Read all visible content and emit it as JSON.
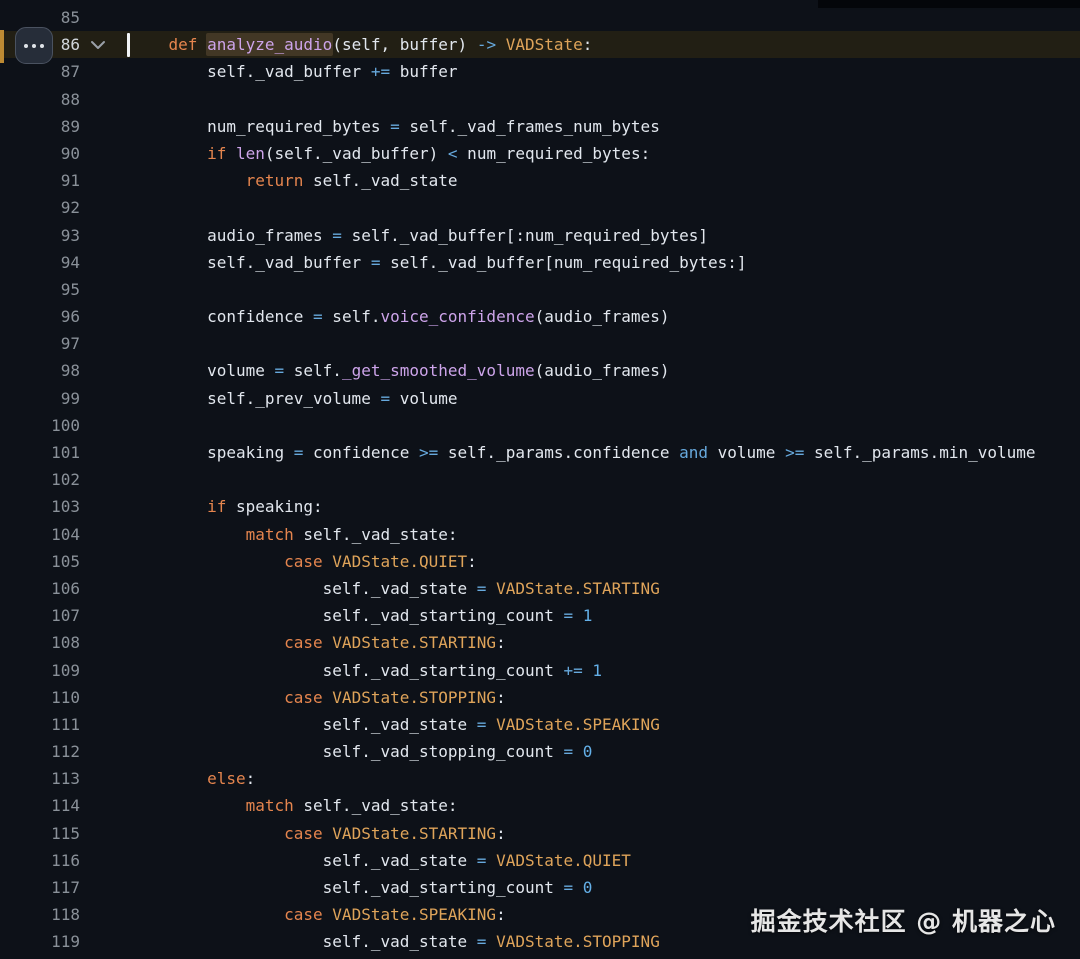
{
  "editor": {
    "colors": {
      "background": "#0d1118",
      "active_line_background": "#221f14",
      "plain": "#e2e7ee",
      "keyword": "#e5854e",
      "class_const": "#dfa45a",
      "function": "#cda4ea",
      "operator": "#67a9dd",
      "number": "#64b0e8",
      "selection_background": "#423725",
      "line_number": "#8a9199",
      "active_line_number": "#d2d7dd",
      "accent_bar": "#bd8a33"
    },
    "gutter": {
      "overflow_icon": "ellipsis-icon",
      "fold_icon": "chevron-down-icon"
    },
    "watermark": "掘金技术社区 @ 机器之心",
    "lines": [
      {
        "num": 85,
        "tokens": []
      },
      {
        "num": 86,
        "active": true,
        "cursor": true,
        "fold": true,
        "tokens": [
          [
            "p",
            "    "
          ],
          [
            "k",
            "def"
          ],
          [
            "p",
            " "
          ],
          [
            "fs",
            "analyze_audio"
          ],
          [
            "p",
            "(self, buffer) "
          ],
          [
            "o",
            "->"
          ],
          [
            "p",
            " "
          ],
          [
            "c",
            "VADState"
          ],
          [
            "p",
            ":"
          ]
        ]
      },
      {
        "num": 87,
        "tokens": [
          [
            "p",
            "        self._vad_buffer "
          ],
          [
            "o",
            "+="
          ],
          [
            "p",
            " buffer"
          ]
        ]
      },
      {
        "num": 88,
        "tokens": []
      },
      {
        "num": 89,
        "tokens": [
          [
            "p",
            "        num_required_bytes "
          ],
          [
            "o",
            "="
          ],
          [
            "p",
            " self._vad_frames_num_bytes"
          ]
        ]
      },
      {
        "num": 90,
        "tokens": [
          [
            "p",
            "        "
          ],
          [
            "k",
            "if"
          ],
          [
            "p",
            " "
          ],
          [
            "f",
            "len"
          ],
          [
            "p",
            "(self._vad_buffer) "
          ],
          [
            "o",
            "<"
          ],
          [
            "p",
            " num_required_bytes:"
          ]
        ]
      },
      {
        "num": 91,
        "tokens": [
          [
            "p",
            "            "
          ],
          [
            "k",
            "return"
          ],
          [
            "p",
            " self._vad_state"
          ]
        ]
      },
      {
        "num": 92,
        "tokens": []
      },
      {
        "num": 93,
        "tokens": [
          [
            "p",
            "        audio_frames "
          ],
          [
            "o",
            "="
          ],
          [
            "p",
            " self._vad_buffer[:num_required_bytes]"
          ]
        ]
      },
      {
        "num": 94,
        "tokens": [
          [
            "p",
            "        self._vad_buffer "
          ],
          [
            "o",
            "="
          ],
          [
            "p",
            " self._vad_buffer[num_required_bytes:]"
          ]
        ]
      },
      {
        "num": 95,
        "tokens": []
      },
      {
        "num": 96,
        "tokens": [
          [
            "p",
            "        confidence "
          ],
          [
            "o",
            "="
          ],
          [
            "p",
            " self."
          ],
          [
            "f",
            "voice_confidence"
          ],
          [
            "p",
            "(audio_frames)"
          ]
        ]
      },
      {
        "num": 97,
        "tokens": []
      },
      {
        "num": 98,
        "tokens": [
          [
            "p",
            "        volume "
          ],
          [
            "o",
            "="
          ],
          [
            "p",
            " self."
          ],
          [
            "f",
            "_get_smoothed_volume"
          ],
          [
            "p",
            "(audio_frames)"
          ]
        ]
      },
      {
        "num": 99,
        "tokens": [
          [
            "p",
            "        self._prev_volume "
          ],
          [
            "o",
            "="
          ],
          [
            "p",
            " volume"
          ]
        ]
      },
      {
        "num": 100,
        "tokens": []
      },
      {
        "num": 101,
        "tokens": [
          [
            "p",
            "        speaking "
          ],
          [
            "o",
            "="
          ],
          [
            "p",
            " confidence "
          ],
          [
            "o",
            ">="
          ],
          [
            "p",
            " self._params.confidence "
          ],
          [
            "o",
            "and"
          ],
          [
            "p",
            " volume "
          ],
          [
            "o",
            ">="
          ],
          [
            "p",
            " self._params.min_volume"
          ]
        ]
      },
      {
        "num": 102,
        "tokens": []
      },
      {
        "num": 103,
        "tokens": [
          [
            "p",
            "        "
          ],
          [
            "k",
            "if"
          ],
          [
            "p",
            " speaking:"
          ]
        ]
      },
      {
        "num": 104,
        "tokens": [
          [
            "p",
            "            "
          ],
          [
            "k",
            "match"
          ],
          [
            "p",
            " self._vad_state:"
          ]
        ]
      },
      {
        "num": 105,
        "tokens": [
          [
            "p",
            "                "
          ],
          [
            "k",
            "case"
          ],
          [
            "p",
            " "
          ],
          [
            "c",
            "VADState.QUIET"
          ],
          [
            "p",
            ":"
          ]
        ]
      },
      {
        "num": 106,
        "tokens": [
          [
            "p",
            "                    self._vad_state "
          ],
          [
            "o",
            "="
          ],
          [
            "p",
            " "
          ],
          [
            "c",
            "VADState.STARTING"
          ]
        ]
      },
      {
        "num": 107,
        "tokens": [
          [
            "p",
            "                    self._vad_starting_count "
          ],
          [
            "o",
            "="
          ],
          [
            "p",
            " "
          ],
          [
            "n",
            "1"
          ]
        ]
      },
      {
        "num": 108,
        "tokens": [
          [
            "p",
            "                "
          ],
          [
            "k",
            "case"
          ],
          [
            "p",
            " "
          ],
          [
            "c",
            "VADState.STARTING"
          ],
          [
            "p",
            ":"
          ]
        ]
      },
      {
        "num": 109,
        "tokens": [
          [
            "p",
            "                    self._vad_starting_count "
          ],
          [
            "o",
            "+="
          ],
          [
            "p",
            " "
          ],
          [
            "n",
            "1"
          ]
        ]
      },
      {
        "num": 110,
        "tokens": [
          [
            "p",
            "                "
          ],
          [
            "k",
            "case"
          ],
          [
            "p",
            " "
          ],
          [
            "c",
            "VADState.STOPPING"
          ],
          [
            "p",
            ":"
          ]
        ]
      },
      {
        "num": 111,
        "tokens": [
          [
            "p",
            "                    self._vad_state "
          ],
          [
            "o",
            "="
          ],
          [
            "p",
            " "
          ],
          [
            "c",
            "VADState.SPEAKING"
          ]
        ]
      },
      {
        "num": 112,
        "tokens": [
          [
            "p",
            "                    self._vad_stopping_count "
          ],
          [
            "o",
            "="
          ],
          [
            "p",
            " "
          ],
          [
            "n",
            "0"
          ]
        ]
      },
      {
        "num": 113,
        "tokens": [
          [
            "p",
            "        "
          ],
          [
            "k",
            "else"
          ],
          [
            "p",
            ":"
          ]
        ]
      },
      {
        "num": 114,
        "tokens": [
          [
            "p",
            "            "
          ],
          [
            "k",
            "match"
          ],
          [
            "p",
            " self._vad_state:"
          ]
        ]
      },
      {
        "num": 115,
        "tokens": [
          [
            "p",
            "                "
          ],
          [
            "k",
            "case"
          ],
          [
            "p",
            " "
          ],
          [
            "c",
            "VADState.STARTING"
          ],
          [
            "p",
            ":"
          ]
        ]
      },
      {
        "num": 116,
        "tokens": [
          [
            "p",
            "                    self._vad_state "
          ],
          [
            "o",
            "="
          ],
          [
            "p",
            " "
          ],
          [
            "c",
            "VADState.QUIET"
          ]
        ]
      },
      {
        "num": 117,
        "tokens": [
          [
            "p",
            "                    self._vad_starting_count "
          ],
          [
            "o",
            "="
          ],
          [
            "p",
            " "
          ],
          [
            "n",
            "0"
          ]
        ]
      },
      {
        "num": 118,
        "tokens": [
          [
            "p",
            "                "
          ],
          [
            "k",
            "case"
          ],
          [
            "p",
            " "
          ],
          [
            "c",
            "VADState.SPEAKING"
          ],
          [
            "p",
            ":"
          ]
        ]
      },
      {
        "num": 119,
        "tokens": [
          [
            "p",
            "                    self._vad_state "
          ],
          [
            "o",
            "="
          ],
          [
            "p",
            " "
          ],
          [
            "c",
            "VADState.STOPPING"
          ]
        ]
      }
    ]
  }
}
